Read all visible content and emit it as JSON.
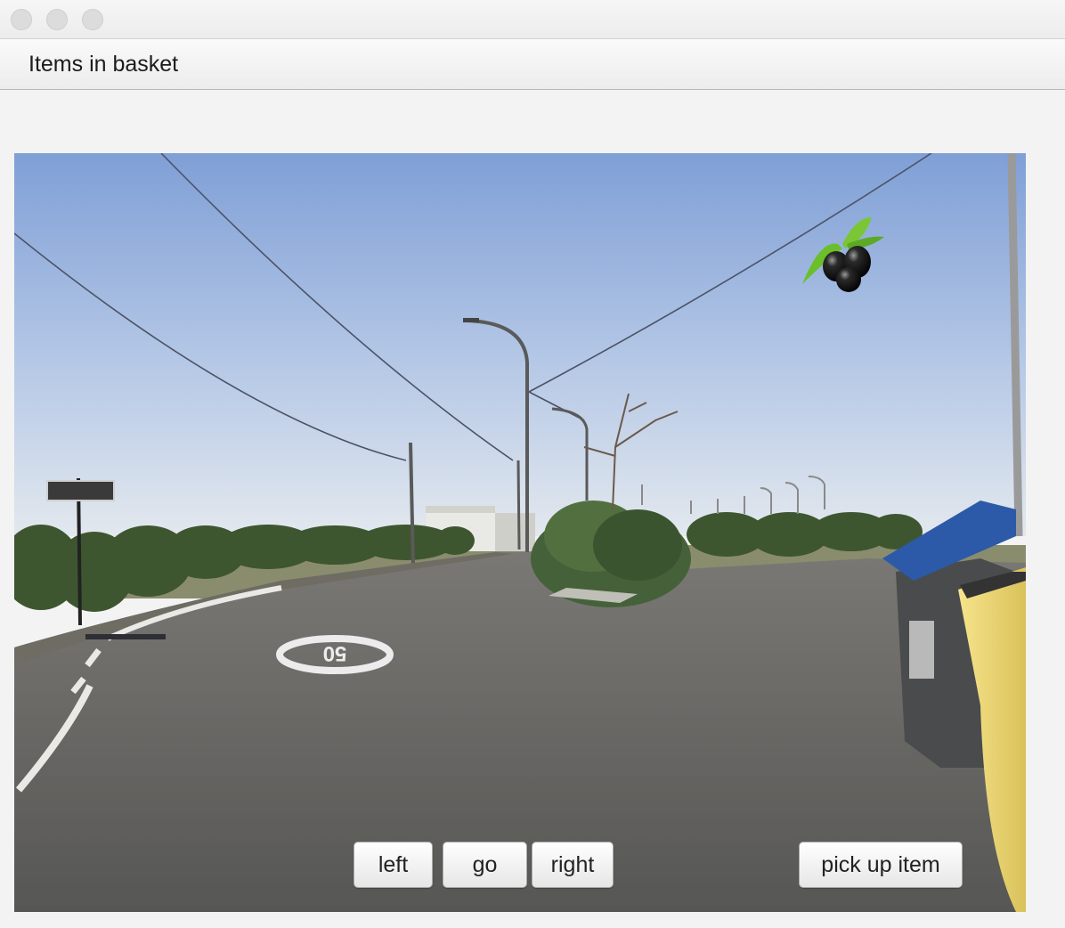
{
  "window": {
    "traffic_lights": [
      "close-dot",
      "minimize-dot",
      "zoom-dot"
    ]
  },
  "menu": {
    "items_in_basket_label": "Items in basket"
  },
  "scene": {
    "item_visible": "olives-icon",
    "road_marking": "50"
  },
  "controls": {
    "left_label": "left",
    "go_label": "go",
    "right_label": "right",
    "pick_up_label": "pick up item"
  },
  "colors": {
    "sky_top": "#7f9fd6",
    "sky_bottom": "#dfe6ef",
    "road": "#5f5f5d",
    "foliage": "#3e5630",
    "bin_blue": "#2c5aa8",
    "bin_yellow": "#f0dc78"
  }
}
